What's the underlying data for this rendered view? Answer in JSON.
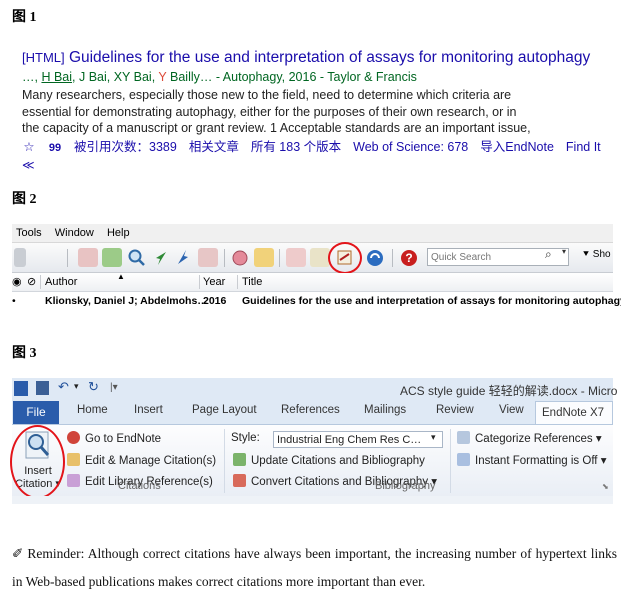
{
  "fig1": {
    "label": "图 1",
    "title_tag": "[HTML]",
    "title": "Guidelines for the use and interpretation of assays for monitoring autophagy",
    "authors_prefix": "…, ",
    "author_link": "H Bai",
    "authors_mid": ", J Bai, XY Bai, ",
    "author_hl": "Y",
    "authors_rest": " Bailly… - Autophagy, 2016 - Taylor & Francis",
    "snippet": [
      "Many researchers, especially those new to the field, need to determine which criteria are",
      "essential for demonstrating autophagy, either for the purposes of their own research, or in",
      "the capacity of a manuscript or grant review. 1 Acceptable standards are an important issue,"
    ],
    "links": {
      "save_icon": "☆",
      "cite_icon": "99",
      "cited_by": "被引用次数：3389",
      "related": "相关文章",
      "versions": "所有 183 个版本",
      "wos": "Web of Science: 678",
      "endnote": "导入EndNote",
      "findit": "Find It"
    },
    "more": "≪"
  },
  "fig2": {
    "label": "图 2",
    "menu": [
      "Tools",
      "Window",
      "Help"
    ],
    "search_placeholder": "Quick Search",
    "show": "Sho",
    "columns": {
      "author": "Author",
      "year": "Year",
      "title": "Title"
    },
    "row": {
      "author": "Klionsky, Daniel J; Abdelmohs…",
      "year": "2016",
      "title": "Guidelines for the use and interpretation of assays for monitoring autophagy"
    }
  },
  "fig3": {
    "label": "图 3",
    "doc_title": "ACS style guide 轻轻的解读.docx - Micro",
    "tabs": [
      "File",
      "Home",
      "Insert",
      "Page Layout",
      "References",
      "Mailings",
      "Review",
      "View",
      "EndNote X7"
    ],
    "insert_citation": [
      "Insert",
      "Citation"
    ],
    "citations_group": {
      "go_to": "Go to EndNote",
      "edit_manage": "Edit & Manage Citation(s)",
      "edit_library": "Edit Library Reference(s)",
      "label": "Citations"
    },
    "bibliography_group": {
      "style_label": "Style:",
      "style_value": "Industrial Eng Chem Res C…",
      "update": "Update Citations and Bibliography",
      "convert": "Convert Citations and Bibliography",
      "label": "Bibliography"
    },
    "right_group": {
      "categorize": "Categorize References",
      "instant": "Instant Formatting is Off"
    }
  },
  "reminder": "✐  Reminder: Although correct citations have always been important, the increasing number of hypertext links in Web-based publications makes correct citations more important than ever.",
  "colors": {
    "link": "#1a0dab",
    "green": "#006621",
    "accent_red": "#e3141a",
    "file_tab": "#2a5cab"
  }
}
